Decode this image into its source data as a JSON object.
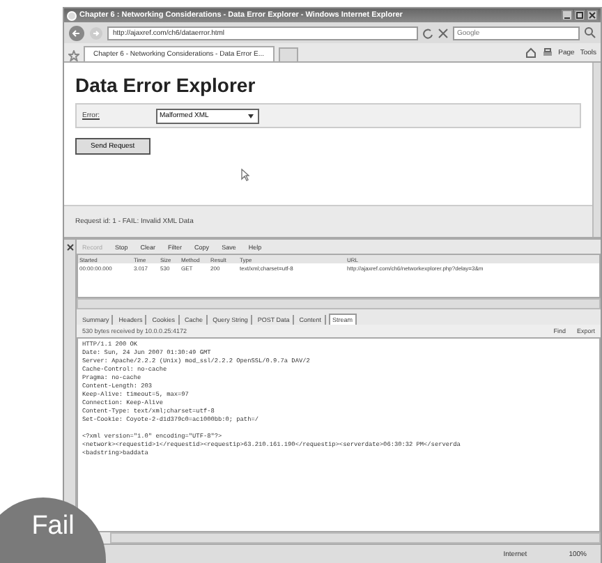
{
  "window": {
    "title": "Chapter 6 : Networking Considerations - Data Error Explorer - Windows Internet Explorer"
  },
  "address_bar": {
    "url": "http://ajaxref.com/ch6/dataerror.html"
  },
  "search": {
    "placeholder": "Google"
  },
  "tabs": [
    {
      "label": "Chapter 6 - Networking Considerations - Data Error E...",
      "selected": true
    }
  ],
  "command_bar": [
    "Page",
    "Tools"
  ],
  "page": {
    "heading": "Data Error Explorer",
    "error_label": "Error:",
    "error_select": "Malformed XML",
    "button": "Send Request",
    "status": "Request id: 1 - FAIL: Invalid XML Data"
  },
  "fiddler": {
    "toolbar": [
      {
        "label": "Record",
        "disabled": true
      },
      {
        "label": "Stop",
        "disabled": false
      },
      {
        "label": "Clear",
        "disabled": false
      },
      {
        "label": "Filter",
        "disabled": false
      },
      {
        "label": "Copy",
        "disabled": false
      },
      {
        "label": "Save",
        "disabled": false
      },
      {
        "label": "Help",
        "disabled": false
      }
    ],
    "columns": [
      "Started",
      "Time",
      "Size",
      "Method",
      "Result",
      "Type",
      "URL"
    ],
    "rows": [
      [
        "00:00:00.000",
        "3.017",
        "530",
        "GET",
        "200",
        "text/xml;charset=utf-8",
        "http://ajaxref.com/ch6/networkexplorer.php?delay=3&m"
      ]
    ],
    "tabs": [
      {
        "label": "Summary",
        "selected": false
      },
      {
        "label": "Headers",
        "selected": false
      },
      {
        "label": "Cookies",
        "selected": false
      },
      {
        "label": "Cache",
        "selected": false
      },
      {
        "label": "Query String",
        "selected": false
      },
      {
        "label": "POST Data",
        "selected": false
      },
      {
        "label": "Content",
        "selected": false
      },
      {
        "label": "Stream",
        "selected": true
      }
    ],
    "info": "530 bytes received by 10.0.0.25:4172",
    "actions": [
      "Find",
      "Export"
    ],
    "header_lines": [
      "HTTP/1.1 200 OK",
      "Date: Sun, 24 Jun 2007 01:30:49 GMT",
      "Server: Apache/2.2.2 (Unix) mod_ssl/2.2.2 OpenSSL/0.9.7a DAV/2",
      "Cache-Control: no-cache",
      "Pragma: no-cache",
      "Content-Length: 203",
      "Keep-Alive: timeout=5, max=97",
      "Connection: Keep-Alive",
      "Content-Type: text/xml;charset=utf-8",
      "Set-Cookie: Coyote-2-d1d379c0=ac1000bb:0; path=/"
    ],
    "body_lines": [
      "<?xml version=\"1.0\" encoding=\"UTF-8\"?>",
      "<network><requestid>1</requestid><requestip>63.210.161.190</requestip><serverdate>06:30:32 PM</serverda",
      "<badstring>baddata"
    ]
  },
  "status_bar": {
    "zone": "Internet",
    "zoom": "100%"
  },
  "badge": {
    "text": "Fail"
  }
}
